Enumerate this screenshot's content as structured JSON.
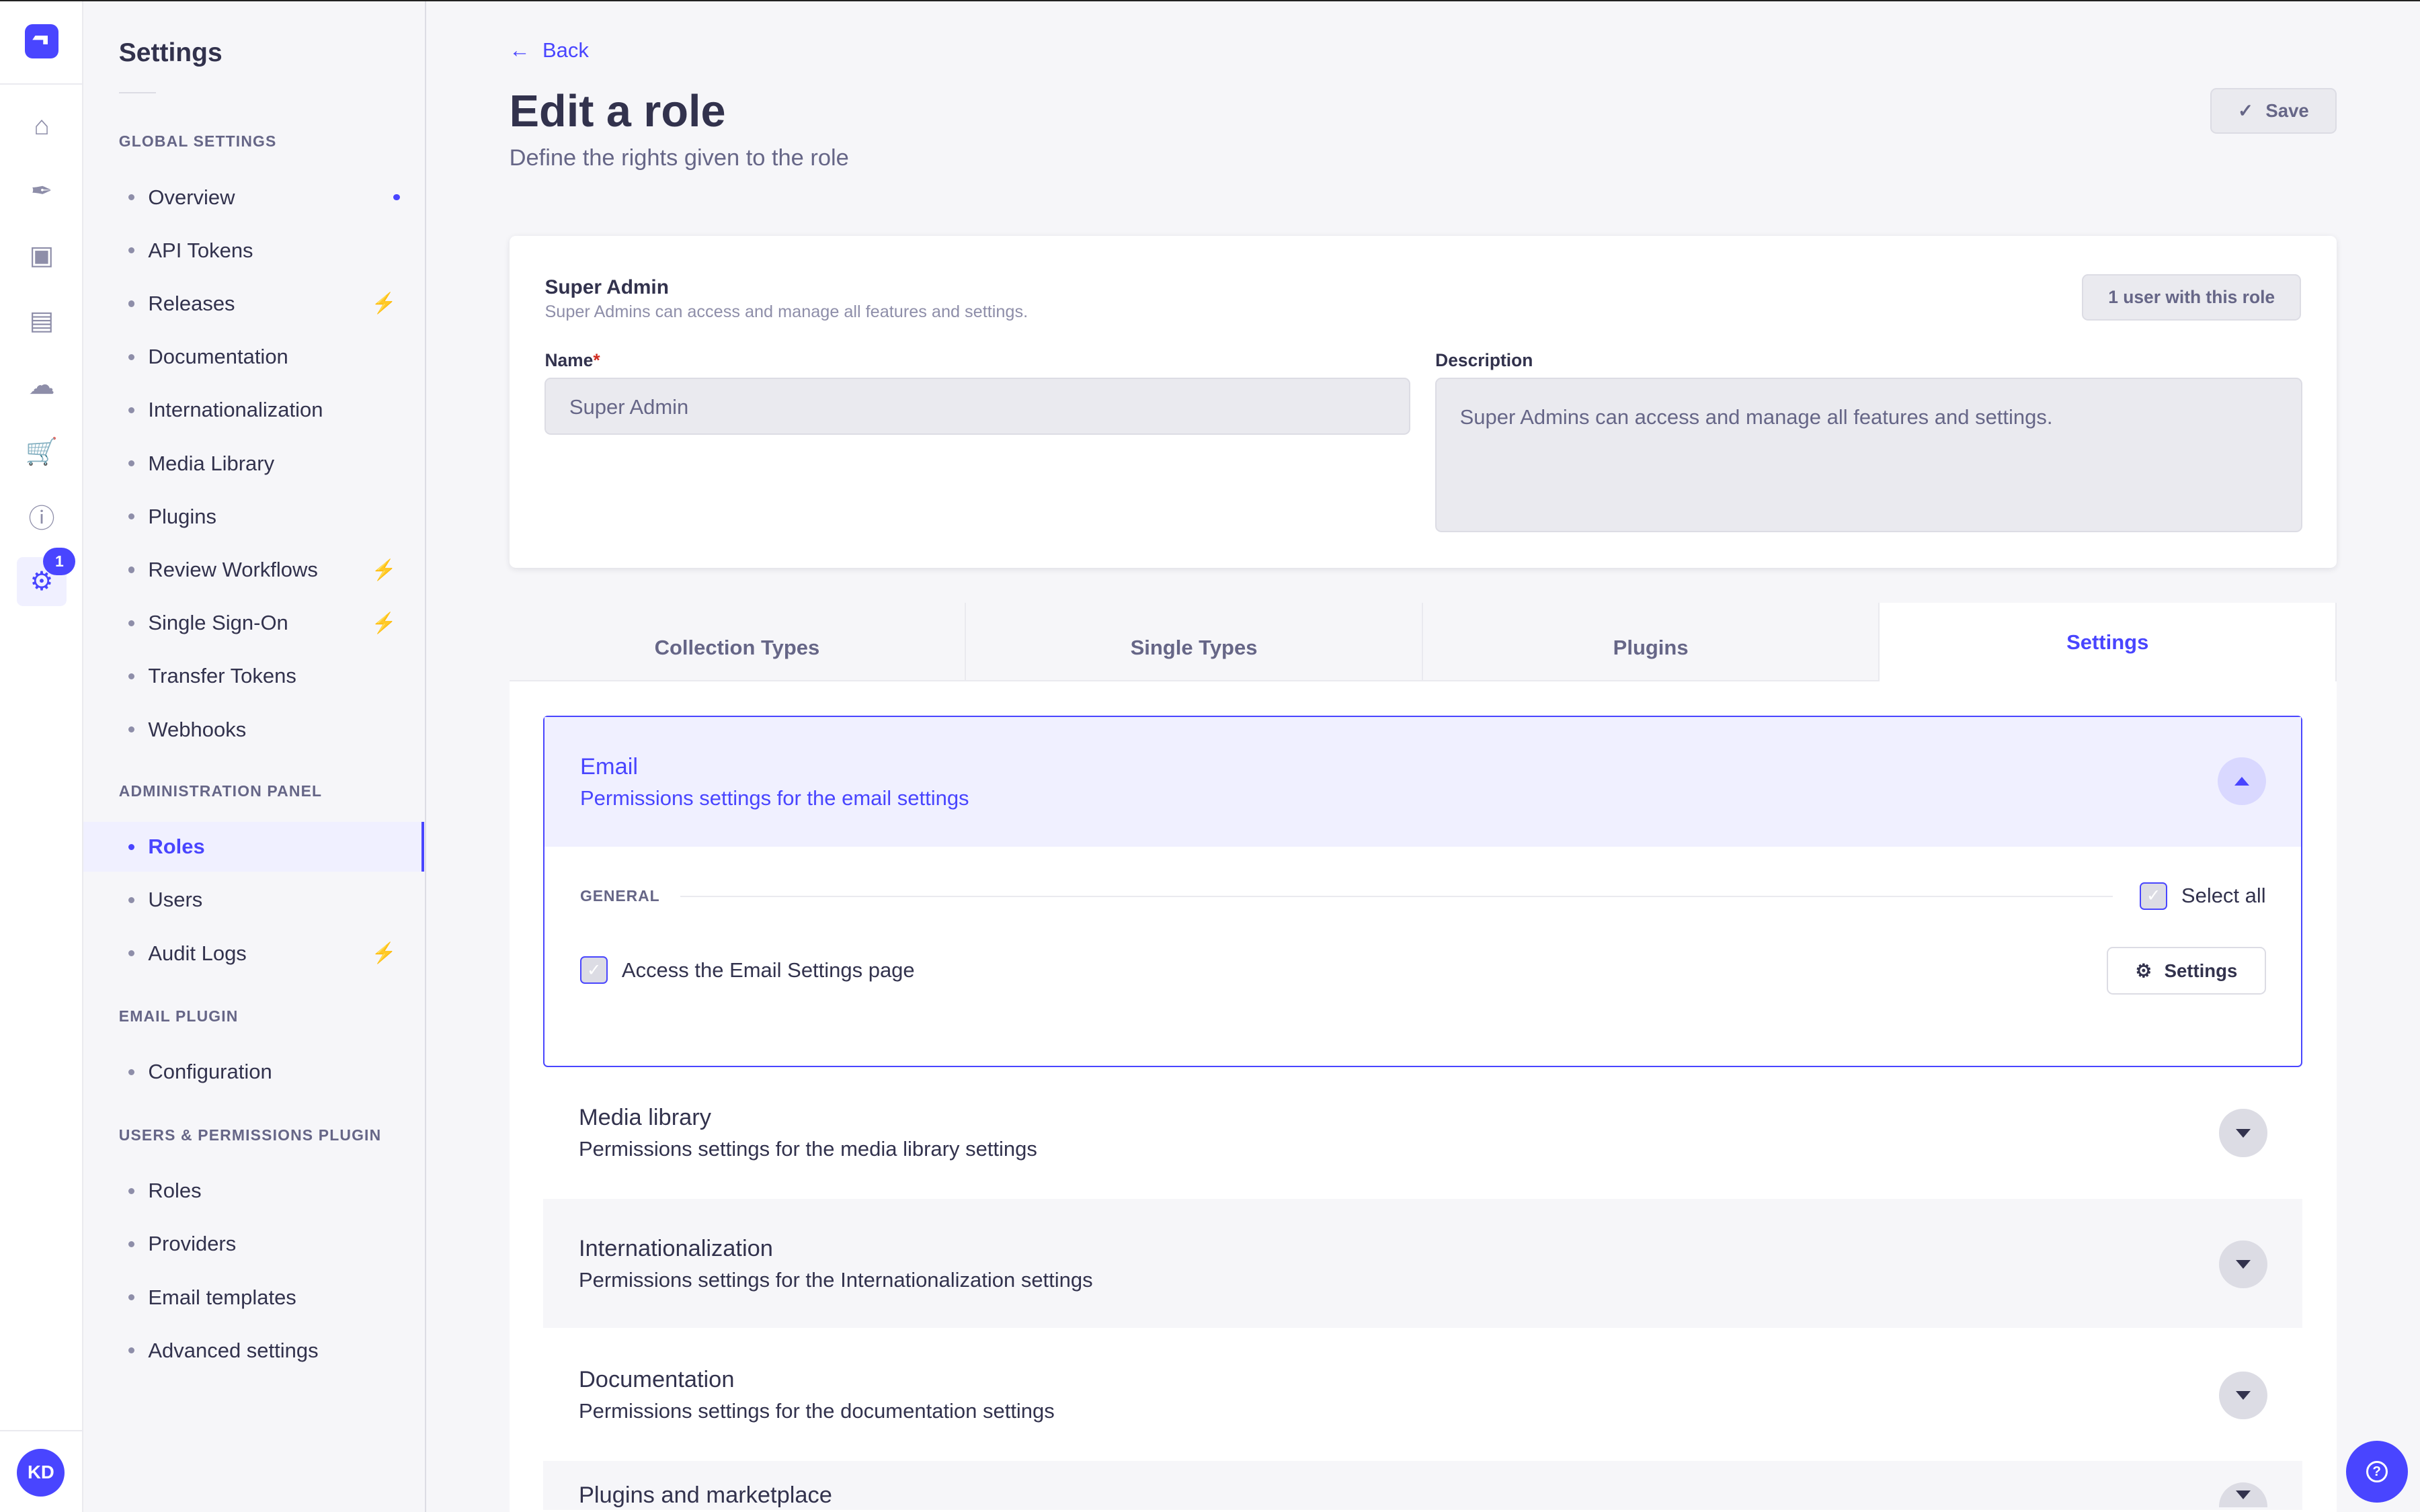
{
  "rail": {
    "badge": "1",
    "avatar": "KD",
    "icons": [
      "home-icon",
      "feather-icon",
      "media-icon",
      "layout-icon",
      "cloud-icon",
      "cart-icon",
      "info-icon",
      "gear-icon"
    ]
  },
  "nav": {
    "title": "Settings",
    "sections": [
      {
        "label": "GLOBAL SETTINGS",
        "items": [
          {
            "label": "Overview",
            "marker": "dot"
          },
          {
            "label": "API Tokens"
          },
          {
            "label": "Releases",
            "marker": "bolt"
          },
          {
            "label": "Documentation"
          },
          {
            "label": "Internationalization"
          },
          {
            "label": "Media Library"
          },
          {
            "label": "Plugins"
          },
          {
            "label": "Review Workflows",
            "marker": "bolt"
          },
          {
            "label": "Single Sign-On",
            "marker": "bolt"
          },
          {
            "label": "Transfer Tokens"
          },
          {
            "label": "Webhooks"
          }
        ]
      },
      {
        "label": "ADMINISTRATION PANEL",
        "items": [
          {
            "label": "Roles",
            "active": true
          },
          {
            "label": "Users"
          },
          {
            "label": "Audit Logs",
            "marker": "bolt"
          }
        ]
      },
      {
        "label": "EMAIL PLUGIN",
        "items": [
          {
            "label": "Configuration"
          }
        ]
      },
      {
        "label": "USERS & PERMISSIONS PLUGIN",
        "items": [
          {
            "label": "Roles"
          },
          {
            "label": "Providers"
          },
          {
            "label": "Email templates"
          },
          {
            "label": "Advanced settings"
          }
        ]
      }
    ]
  },
  "header": {
    "back": "Back",
    "title": "Edit a role",
    "subtitle": "Define the rights given to the role",
    "save": "Save"
  },
  "role": {
    "name": "Super Admin",
    "description": "Super Admins can access and manage all features and settings.",
    "users": "1 user with this role",
    "name_label": "Name",
    "required": "*",
    "description_label": "Description",
    "name_value": "Super Admin",
    "description_value": "Super Admins can access and manage all features and settings."
  },
  "tabs": [
    {
      "label": "Collection Types"
    },
    {
      "label": "Single Types"
    },
    {
      "label": "Plugins"
    },
    {
      "label": "Settings",
      "active": true
    }
  ],
  "email": {
    "title": "Email",
    "subtitle": "Permissions settings for the email settings",
    "general": "GENERAL",
    "select_all": "Select all",
    "permission": "Access the Email Settings page",
    "settings_btn": "Settings"
  },
  "accordions": [
    {
      "title": "Media library",
      "subtitle": "Permissions settings for the media library settings"
    },
    {
      "title": "Internationalization",
      "subtitle": "Permissions settings for the Internationalization settings"
    },
    {
      "title": "Documentation",
      "subtitle": "Permissions settings for the documentation settings"
    },
    {
      "title": "Plugins and marketplace",
      "subtitle": ""
    }
  ],
  "colors": {
    "primary": "#4945ff",
    "warning": "#f29d41"
  }
}
